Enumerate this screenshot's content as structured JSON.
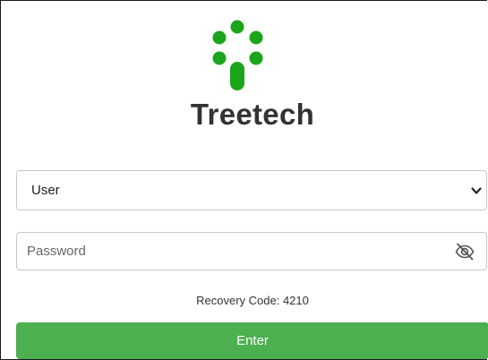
{
  "brand": {
    "name": "Treetech",
    "logo_icon": "tree-dots-logo",
    "logo_color": "#1aa51a"
  },
  "login": {
    "user_select": {
      "selected": "User",
      "options": [
        "User"
      ]
    },
    "password": {
      "placeholder": "Password",
      "value": "",
      "toggle_icon": "eye-slash-icon"
    },
    "recovery_code": "Recovery Code: 4210",
    "enter_label": "Enter",
    "enter_color": "#4caf50"
  }
}
